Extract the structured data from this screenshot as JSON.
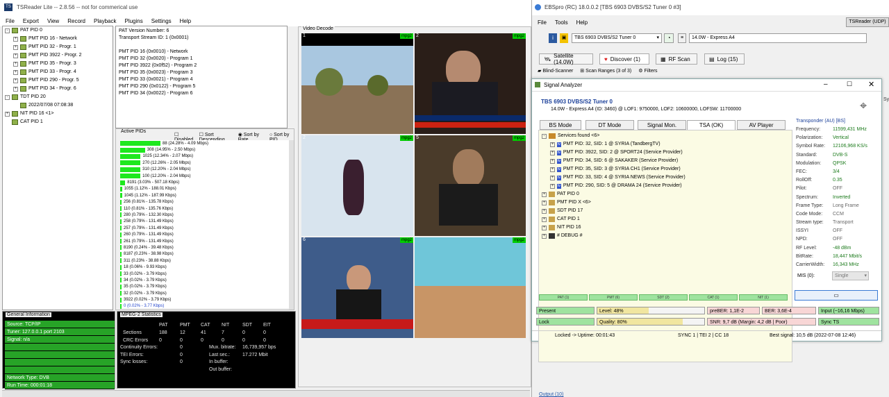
{
  "tsreader": {
    "title": "TSReader Lite -- 2.8.56 -- not for commerical use",
    "menu": [
      "File",
      "Export",
      "View",
      "Record",
      "Playback",
      "Plugins",
      "Settings",
      "Help"
    ],
    "tree": [
      {
        "label": "PAT PID 0",
        "level": 0,
        "exp": "-"
      },
      {
        "label": "PMT PID 16 - Network",
        "level": 1,
        "exp": "+"
      },
      {
        "label": "PMT PID 32 - Progr. 1",
        "level": 1,
        "exp": "+"
      },
      {
        "label": "PMT PID 3922 - Progr. 2",
        "level": 1,
        "exp": "+"
      },
      {
        "label": "PMT PID 35 - Progr. 3",
        "level": 1,
        "exp": "+"
      },
      {
        "label": "PMT PID 33 - Progr. 4",
        "level": 1,
        "exp": "+"
      },
      {
        "label": "PMT PID 290 - Progr. 5",
        "level": 1,
        "exp": "+"
      },
      {
        "label": "PMT PID 34 - Progr. 6",
        "level": 1,
        "exp": "+"
      },
      {
        "label": "TDT PID 20",
        "level": 0,
        "exp": "-"
      },
      {
        "label": "2022/07/08 07:08:38",
        "level": 1,
        "exp": ""
      },
      {
        "label": "NIT PID 16 <1>",
        "level": 0,
        "exp": "+"
      },
      {
        "label": "CAT PID 1",
        "level": 0,
        "exp": ""
      }
    ],
    "pat_info": [
      "PAT Version Number: 6",
      "Transport Stream ID: 1 (0x0001)",
      "",
      "PMT PID 16 (0x0010) - Network",
      "PMT PID 32 (0x0020) - Program 1",
      "PMT PID 3922 (0x0f52) - Program 2",
      "PMT PID 35 (0x0023) - Program 3",
      "PMT PID 33 (0x0021) - Program 4",
      "PMT PID 290 (0x0122) - Program 5",
      "PMT PID 34 (0x0022) - Program 6"
    ],
    "active_pids_label": "Active PIDs",
    "pid_options": [
      "Disabled",
      "Sort Descending",
      "Sort by Rate",
      "Sort by PID"
    ],
    "pids": [
      {
        "t": "88 (24.28% - 4.09 Mbps)",
        "pct": 24.28
      },
      {
        "t": "308 (14.95% - 2.50 Mbps)",
        "pct": 14.95
      },
      {
        "t": "1025 (12.34% - 2.07 Mbps)",
        "pct": 12.34
      },
      {
        "t": "270 (12.26% - 2.05 Mbps)",
        "pct": 12.26
      },
      {
        "t": "310 (12.20% - 2.04 Mbps)",
        "pct": 12.2
      },
      {
        "t": "100 (12.20% - 2.04 Mbps)",
        "pct": 12.2
      },
      {
        "t": "8191 (3.03% - 507.18 Kbps)",
        "pct": 3.03
      },
      {
        "t": "1055 (1.12% - 188.01 Kbps)",
        "pct": 1.12
      },
      {
        "t": "1045 (1.12% - 187.99 Kbps)",
        "pct": 1.12
      },
      {
        "t": "256 (0.81% - 135.78 Kbps)",
        "pct": 0.81
      },
      {
        "t": "110 (0.81% - 135.76 Kbps)",
        "pct": 0.81
      },
      {
        "t": "280 (0.79% - 132.30 Kbps)",
        "pct": 0.79
      },
      {
        "t": "258 (0.79% - 131.49 Kbps)",
        "pct": 0.79
      },
      {
        "t": "257 (0.79% - 131.49 Kbps)",
        "pct": 0.79
      },
      {
        "t": "260 (0.79% - 131.49 Kbps)",
        "pct": 0.79
      },
      {
        "t": "261 (0.79% - 131.49 Kbps)",
        "pct": 0.79
      },
      {
        "t": "8190 (0.24% - 39.48 Kbps)",
        "pct": 0.24
      },
      {
        "t": "8187 (0.23% - 38.98 Kbps)",
        "pct": 0.23
      },
      {
        "t": "311 (0.23% - 38.88 Kbps)",
        "pct": 0.23
      },
      {
        "t": "18 (0.06% - 9.93 Kbps)",
        "pct": 0.06
      },
      {
        "t": "33 (0.02% - 3.79 Kbps)",
        "pct": 0.02
      },
      {
        "t": "34 (0.02% - 3.79 Kbps)",
        "pct": 0.02
      },
      {
        "t": "35 (0.02% - 3.79 Kbps)",
        "pct": 0.02
      },
      {
        "t": "32 (0.02% - 3.79 Kbps)",
        "pct": 0.02
      },
      {
        "t": "3922 (0.02% - 3.79 Kbps)",
        "pct": 0.02
      },
      {
        "t": "0 (0.02% - 3.77 Kbps)",
        "pct": 0.02
      }
    ],
    "general_info_label": "General Information",
    "general_info": [
      "Source: TCP/IP",
      "Tuner: 127.0.0.1 port 2103",
      "Signal: n/a",
      "",
      "",
      "",
      "",
      "Network Type: DVB",
      "Run Time: 000:01:18"
    ],
    "mpeg_label": "MPEG-2 Statistics",
    "mpeg_header": [
      "",
      "PAT",
      "PMT",
      "CAT",
      "NIT",
      "SDT",
      "EIT"
    ],
    "mpeg_rows": [
      [
        "Sections",
        "188",
        "12",
        "41",
        "7",
        "0",
        "0"
      ],
      [
        "CRC Errors",
        "0",
        "0",
        "0",
        "0",
        "0",
        "0"
      ]
    ],
    "mpeg_extra": [
      [
        "Continuity Errors:",
        "0",
        "Mux. bitrate:",
        "16,739,957 bps"
      ],
      [
        "TEI Errors:",
        "0",
        "Last sec.:",
        "17.272 Mbit"
      ],
      [
        "Sync losses:",
        "0",
        "In buffer:",
        ""
      ],
      [
        "",
        "",
        "Out buffer:",
        ""
      ]
    ],
    "video_label": "Video Decode",
    "video_tiles": [
      {
        "n": "1",
        "tag": "mpg2"
      },
      {
        "n": "2",
        "tag": "mpg2"
      },
      {
        "n": "2",
        "tag": "mpg2"
      },
      {
        "n": "5",
        "tag": "mpg2"
      },
      {
        "n": "6",
        "tag": "mpg2"
      },
      {
        "n": "",
        "tag": "mpg2"
      }
    ]
  },
  "ebs": {
    "title": "EBSpro (RC) 18.0.0.2 [TBS 6903 DVBS/S2 Tuner 0 #3]",
    "menu": [
      "File",
      "Tools",
      "Help"
    ],
    "tsreader_btn": "TSReader (UDP)",
    "tuner_select": "TBS 6903 DVBS/S2 Tuner 0",
    "sat_select": "14.0W - Express A4",
    "tabs": [
      "Satellite (14.0W)",
      "Discover (1)",
      "RF Scan",
      "Log (15)"
    ],
    "tabs2": [
      "Blind-Scanner",
      "Scan Ranges (3 of 3)",
      "Filters"
    ],
    "output_label": "Output (10)"
  },
  "analyzer": {
    "title": "Signal Analyzer",
    "tuner": "TBS 6903 DVBS/S2 Tuner 0",
    "info": "14.0W - Express A4 (ID: 3460) @ LOF1: 9750000, LOF2: 10600000, LOFSW: 11700000",
    "tabs": [
      "BS Mode",
      "DT Mode",
      "Signal Mon.",
      "TSA (OK)",
      "AV Player"
    ],
    "services_header": "Services found <6>",
    "services": [
      "PMT PID: 32, SID: 1 @ SYRIA (TandbergTV)",
      "PMT PID: 3922, SID: 2 @ SPORT24 (Service Provider)",
      "PMT PID: 34, SID: 6 @ SAKAKER (Service Provider)",
      "PMT PID: 35, SID: 3 @ SYRIA CH1 (Service Provider)",
      "PMT PID: 33, SID: 4 @ SYRIA NEWS (Service Provider)",
      "PMT PID: 290, SID: 5 @ DRAMA 24 (Service Provider)"
    ],
    "tables": [
      "PAT PID 0",
      "PMT PID X <6>",
      "SDT PID 17",
      "CAT PID 1",
      "NIT PID 16",
      "# DEBUG #"
    ],
    "mini_bars": [
      "PAT (1)",
      "PMT (6)",
      "SDT (2)",
      "CAT (1)",
      "NIT (1)"
    ],
    "transponder_label": "Transponder (AU) [BS]",
    "transponder": [
      [
        "Frequency:",
        "11599,431 MHz"
      ],
      [
        "Polarization:",
        "Vertical"
      ],
      [
        "Symbol Rate:",
        "12106,968 KS/s"
      ],
      [
        "Standard:",
        "DVB-S"
      ],
      [
        "Modulation:",
        "QPSK"
      ],
      [
        "FEC:",
        "3/4"
      ],
      [
        "RollOff:",
        "0.35"
      ],
      [
        "Pilot:",
        "OFF"
      ],
      [
        "Spectrum:",
        "Inverted"
      ],
      [
        "Frame Type:",
        "Long Frame"
      ],
      [
        "Code Mode:",
        "CCM"
      ],
      [
        "Stream type:",
        "Transport"
      ],
      [
        "ISSYI",
        "OFF"
      ],
      [
        "NPD:",
        "OFF"
      ],
      [
        "RF Level:",
        "-48 dBm"
      ],
      [
        "BitRate:",
        "18,447 Mbit/s"
      ],
      [
        "CarrierWidth:",
        "16,343 MHz"
      ]
    ],
    "mis_label": "MIS (0):",
    "mis_value": "Single",
    "status_row1": [
      "Present",
      "Level: 48%",
      "preBER: 1,1E-2",
      "BER: 3,6E-4",
      "Input (~16,16 Mbps)"
    ],
    "status_row2": [
      "Lock",
      "Quality: 80%",
      "SNR: 9,7 dB (Margin: 4,2 dB | Poor)",
      "Sync TS"
    ],
    "level_pct": 48,
    "quality_pct": 80,
    "footer": [
      "Locked -> Uptime: 00:01:43",
      "SYNC 1 | TEI 2 | CC 18",
      "Best signal: 10,5 dB (2022-07-08 12:46)"
    ]
  }
}
